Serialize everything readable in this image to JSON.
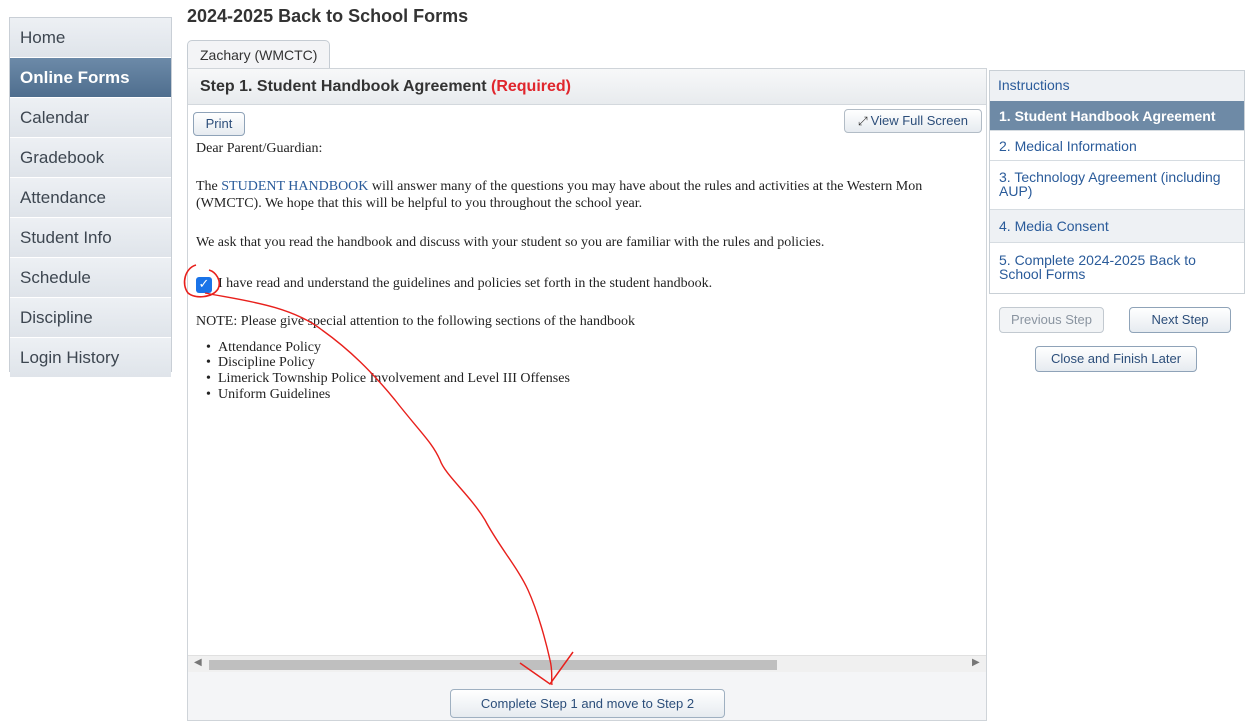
{
  "nav": {
    "items": [
      {
        "label": "Home"
      },
      {
        "label": "Online Forms"
      },
      {
        "label": "Calendar"
      },
      {
        "label": "Gradebook"
      },
      {
        "label": "Attendance"
      },
      {
        "label": "Student Info"
      },
      {
        "label": "Schedule"
      },
      {
        "label": "Discipline"
      },
      {
        "label": "Login History"
      }
    ],
    "active": "Online Forms"
  },
  "page": {
    "title": "2024-2025 Back to School Forms",
    "tab": "Zachary (WMCTC)"
  },
  "step": {
    "title": "Step 1. Student Handbook Agreement",
    "required": "(Required)"
  },
  "toolbar": {
    "print": "Print",
    "fullscreen": "View Full Screen",
    "fullscreen_icon": "expand-icon"
  },
  "doc": {
    "greeting": "Dear Parent/Guardian:",
    "intro_pre": "The",
    "intro_link": "STUDENT HANDBOOK",
    "intro_post": "will answer many of the questions you may have about the rules and activities at the Western Mon",
    "intro_line2": "(WMCTC). We hope that this will be helpful to you throughout the school year.",
    "ask": "We ask that you read the handbook and discuss with your student so you are familiar with the rules and policies.",
    "checkbox_checked": true,
    "checkbox_label": "I have read and understand the guidelines and policies set forth in the student handbook.",
    "note": "NOTE: Please give special attention to the following sections of the handbook",
    "sections": [
      "Attendance Policy",
      "Discipline Policy",
      "Limerick Township Police Involvement and Level III Offenses",
      "Uniform Guidelines"
    ]
  },
  "footer": {
    "complete": "Complete Step 1 and move to Step 2"
  },
  "steps_panel": {
    "instructions": "Instructions",
    "steps": [
      "1. Student Handbook Agreement",
      "2. Medical Information",
      "3. Technology Agreement (including AUP)",
      "4. Media Consent",
      "5. Complete 2024-2025 Back to School Forms"
    ],
    "active_index": 0,
    "highlighted_index": 1
  },
  "actions": {
    "previous": "Previous Step",
    "next": "Next Step",
    "close": "Close and Finish Later"
  },
  "colors": {
    "nav_active": "#5b7a9a",
    "required": "#e0262d",
    "link": "#2a5b9a",
    "highlight": "#f3f33c",
    "annotation": "#e8201c"
  }
}
